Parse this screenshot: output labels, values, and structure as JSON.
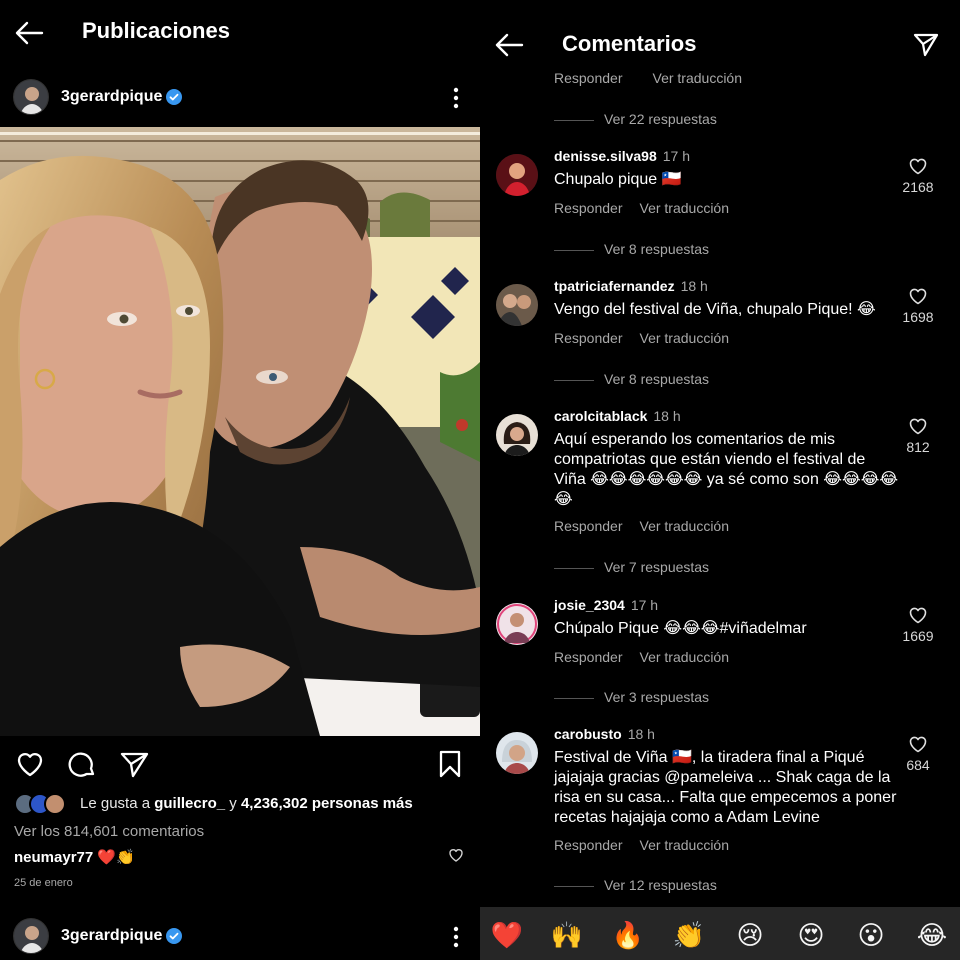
{
  "left": {
    "header": {
      "title": "Publicaciones"
    },
    "post": {
      "username": "3gerardpique",
      "likes_prefix": "Le gusta a",
      "liked_by_user": "guillecro_",
      "likes_connector": "y",
      "likes_rest": "4,236,302 personas más",
      "view_comments": "Ver los 814,601 comentarios",
      "first_comment": {
        "user": "neumayr77",
        "text": "❤️👏"
      },
      "date": "25 de enero"
    },
    "next_post": {
      "username": "3gerardpique"
    }
  },
  "right": {
    "header": {
      "title": "Comentarios"
    },
    "clipped": {
      "reply": "Responder",
      "translate": "Ver traducción"
    },
    "reply_label": "Responder",
    "translate_label": "Ver traducción",
    "replies": [
      "Ver 22 respuestas",
      "Ver 8 respuestas",
      "Ver 8 respuestas",
      "Ver 7 respuestas",
      "Ver 3 respuestas",
      "Ver 12 respuestas"
    ],
    "comments": [
      {
        "user": "denisse.silva98",
        "time": "17 h",
        "text": "Chupalo pique 🇨🇱",
        "likes": "2168"
      },
      {
        "user": "tpatriciafernandez",
        "time": "18 h",
        "text": "Vengo del festival de Viña, chupalo Pique! 😂",
        "likes": "1698"
      },
      {
        "user": "carolcitablack",
        "time": "18 h",
        "text": "Aquí esperando los comentarios de mis compatriotas que están viendo el festival de Viña 😂😂😂😂😂😂 ya sé como son 😂😂😂😂😂",
        "likes": "812"
      },
      {
        "user": "josie_2304",
        "time": "17 h",
        "text": "Chúpalo Pique 😂😂😂#viñadelmar",
        "likes": "1669"
      },
      {
        "user": "carobusto",
        "time": "18 h",
        "text": "Festival de Viña 🇨🇱, la tiradera final a Piqué jajajaja gracias @pameleiva ... Shak caga de la risa en su casa... Falta que empecemos a poner recetas hajajaja como a Adam Levine",
        "likes": "684"
      }
    ],
    "emoji_bar": [
      "❤️",
      "🙌",
      "🔥",
      "👏",
      "😢",
      "😍",
      "😮",
      "😂"
    ]
  }
}
